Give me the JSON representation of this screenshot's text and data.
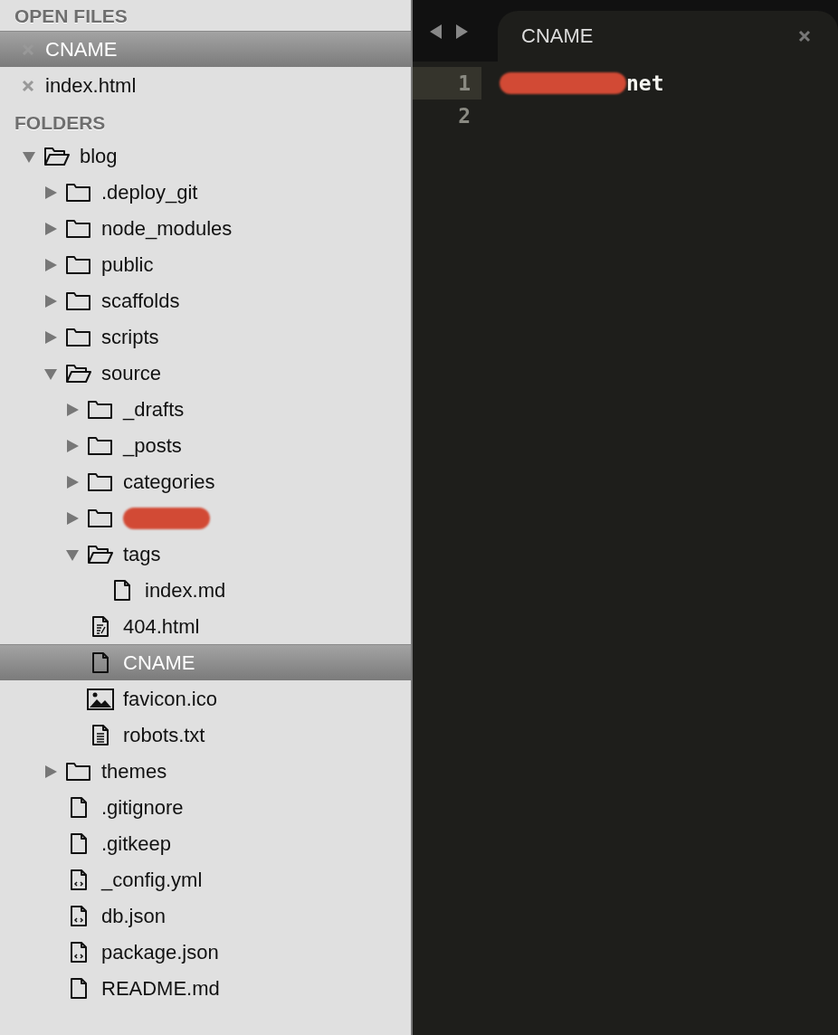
{
  "sidebar": {
    "open_files": {
      "title": "OPEN FILES",
      "items": [
        {
          "name": "CNAME",
          "selected": true
        },
        {
          "name": "index.html",
          "selected": false
        }
      ]
    },
    "folders": {
      "title": "FOLDERS",
      "tree": [
        {
          "kind": "folder",
          "name": "blog",
          "expanded": true,
          "selected": false,
          "children": [
            {
              "kind": "folder",
              "name": ".deploy_git",
              "expanded": false,
              "selected": false
            },
            {
              "kind": "folder",
              "name": "node_modules",
              "expanded": false,
              "selected": false
            },
            {
              "kind": "folder",
              "name": "public",
              "expanded": false,
              "selected": false
            },
            {
              "kind": "folder",
              "name": "scaffolds",
              "expanded": false,
              "selected": false
            },
            {
              "kind": "folder",
              "name": "scripts",
              "expanded": false,
              "selected": false
            },
            {
              "kind": "folder",
              "name": "source",
              "expanded": true,
              "selected": false,
              "children": [
                {
                  "kind": "folder",
                  "name": "_drafts",
                  "expanded": false,
                  "selected": false
                },
                {
                  "kind": "folder",
                  "name": "_posts",
                  "expanded": false,
                  "selected": false
                },
                {
                  "kind": "folder",
                  "name": "categories",
                  "expanded": false,
                  "selected": false
                },
                {
                  "kind": "folder",
                  "redacted": true,
                  "expanded": false,
                  "selected": false
                },
                {
                  "kind": "folder",
                  "name": "tags",
                  "expanded": true,
                  "selected": false,
                  "children": [
                    {
                      "kind": "file",
                      "name": "index.md",
                      "selected": false
                    }
                  ]
                },
                {
                  "kind": "markup",
                  "name": "404.html",
                  "selected": false
                },
                {
                  "kind": "file",
                  "name": "CNAME",
                  "selected": true
                },
                {
                  "kind": "image",
                  "name": "favicon.ico",
                  "selected": false
                },
                {
                  "kind": "text",
                  "name": "robots.txt",
                  "selected": false
                }
              ]
            },
            {
              "kind": "folder",
              "name": "themes",
              "expanded": false,
              "selected": false
            },
            {
              "kind": "file",
              "name": ".gitignore",
              "selected": false
            },
            {
              "kind": "file",
              "name": ".gitkeep",
              "selected": false
            },
            {
              "kind": "code",
              "name": "_config.yml",
              "selected": false
            },
            {
              "kind": "code",
              "name": "db.json",
              "selected": false
            },
            {
              "kind": "code",
              "name": "package.json",
              "selected": false
            },
            {
              "kind": "file",
              "name": "README.md",
              "selected": false
            }
          ]
        }
      ]
    }
  },
  "editor": {
    "tabs": [
      {
        "label": "CNAME",
        "selected": true
      }
    ],
    "lines": [
      {
        "number": "1",
        "text": "net",
        "redacted": true,
        "current": true
      },
      {
        "number": "2",
        "current": false
      }
    ]
  }
}
